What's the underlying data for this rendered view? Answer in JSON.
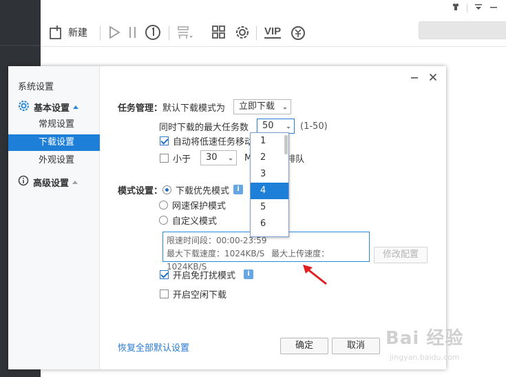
{
  "toolbar": {
    "new_label": "新建",
    "vip_label": "VIP"
  },
  "dialog": {
    "title": "系统设置",
    "nav": {
      "basic_group": "基本设置",
      "items": [
        "常规设置",
        "下载设置",
        "外观设置"
      ],
      "active_index": 1,
      "advanced_group": "高级设置"
    },
    "task": {
      "section_label": "任务管理：",
      "default_mode_label": "默认下载模式为",
      "default_mode_value": "立即下载",
      "max_tasks_label": "同时下载的最大任务数",
      "max_tasks_value": "50",
      "max_tasks_range": "(1-50)",
      "auto_move_label": "自动将低速任务移动至",
      "less_than_label": "小于",
      "less_than_value": "30",
      "less_than_unit": "M",
      "queue_label": "排队"
    },
    "mode": {
      "section_label": "模式设置：",
      "options": [
        "下载优先模式",
        "网速保护模式",
        "自定义模式"
      ],
      "selected_index": 0,
      "limit_period": "限速时间段：00:00-23:59",
      "max_download_speed": "最大下载速度：1024KB/S",
      "max_upload_speed": "最大上传速度：1024KB/S",
      "modify_config_button": "修改配置",
      "dnd_label": "开启免打扰模式",
      "idle_label": "开启空闲下载"
    },
    "restore_defaults_link": "恢复全部默认设置",
    "ok_button": "确定",
    "cancel_button": "取消",
    "dropdown": {
      "options": [
        "1",
        "2",
        "3",
        "4",
        "5",
        "6"
      ],
      "highlighted_index": 3
    }
  },
  "watermark": {
    "text": "Bai 经验",
    "sub": "jingyan.baidu.com"
  },
  "colors": {
    "accent": "#1e7fd8",
    "sidebar_dark": "#2f3236",
    "arrow_red": "#e02020"
  }
}
